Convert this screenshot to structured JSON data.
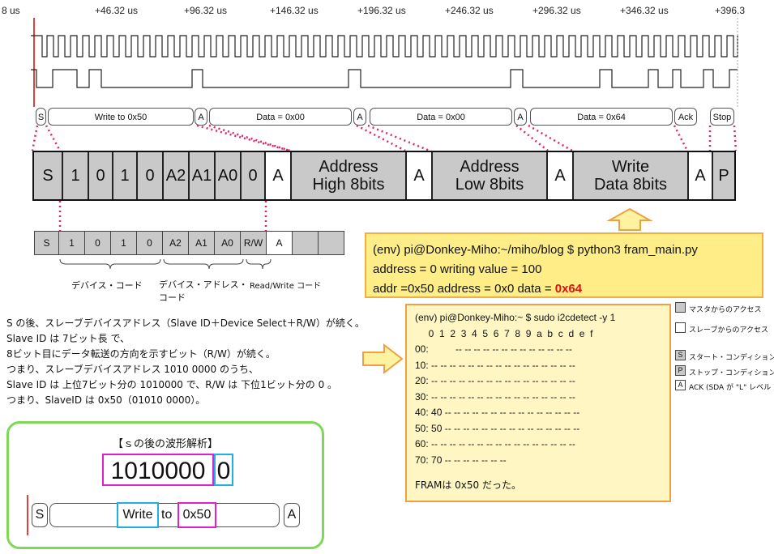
{
  "timeline": {
    "ticks": [
      "8 us",
      "+46.32 us",
      "+96.32 us",
      "+146.32 us",
      "+196.32 us",
      "+246.32 us",
      "+296.32 us",
      "+346.32 us",
      "+396.3"
    ]
  },
  "decode": {
    "s": "S",
    "write": "Write to 0x50",
    "a1": "A",
    "data1": "Data = 0x00",
    "a2": "A",
    "data2": "Data = 0x00",
    "a3": "A",
    "data3": "Data = 0x64",
    "ack": "Ack",
    "stop": "Stop"
  },
  "frame": {
    "s": "S",
    "b1": "1",
    "b2": "0",
    "b3": "1",
    "b4": "0",
    "a2": "A2",
    "a1": "A1",
    "a0": "A0",
    "rw": "0",
    "ack1": "A",
    "addr_high": "Address\nHigh 8bits",
    "ack2": "A",
    "addr_low": "Address\nLow 8bits",
    "ack3": "A",
    "write_data": "Write\nData 8bits",
    "ack4": "A",
    "p": "P"
  },
  "small_table": {
    "cells": [
      "S",
      "1",
      "0",
      "1",
      "0",
      "A2",
      "A1",
      "A0",
      "R/W",
      "A",
      "",
      ""
    ],
    "label_device_code": "デバイス・コード",
    "label_device_address": "デバイス・アドレス・\nコード",
    "label_rw": "Read/Write コード"
  },
  "python_box": {
    "line1": "(env) pi@Donkey-Miho:~/miho/blog $ python3 fram_main.py",
    "line2": "address = 0 writing value = 100",
    "line3_prefix": "addr =0x50 address = 0x0 data = ",
    "line3_value": "0x64"
  },
  "i2c_box": {
    "lines": [
      "(env) pi@Donkey-Miho:~ $ sudo i2cdetect -y 1",
      "     0  1  2  3  4  5  6  7  8  9  a  b  c  d  e  f",
      "00:          -- -- -- -- -- -- -- -- -- -- -- -- --",
      "10: -- -- -- -- -- -- -- -- -- -- -- -- -- -- -- --",
      "20: -- -- -- -- -- -- -- -- -- -- -- -- -- -- -- --",
      "30: -- -- -- -- -- -- -- -- -- -- -- -- -- -- -- --",
      "40: 40 -- -- -- -- -- -- -- -- -- -- -- -- -- -- --",
      "50: 50 -- -- -- -- -- -- -- -- -- -- -- -- -- -- --",
      "60: -- -- -- -- -- -- -- -- -- -- -- -- -- -- -- --",
      "70: 70 -- -- -- -- -- -- --"
    ],
    "footer": "FRAMは 0x50 だった。"
  },
  "explanation": {
    "lines": [
      "S の後、スレーブデバイスアドレス（Slave ID＋Device Select＋R/W）が続く。",
      "Slave ID は 7ビット長 で、",
      "8ビット目にデータ転送の方向を示すビット（R/W）が続く。",
      "つまり、スレーブデバイスアドレス 1010 0000 のうち、",
      "Slave ID は 上位7ビット分の 1010000 で、R/W は 下位1ビット分の 0 。",
      "つまり、SlaveID は 0x50（01010 0000）。"
    ]
  },
  "analysis": {
    "title": "【ｓの後の波形解析】",
    "bits_main": "1010000",
    "bits_last": "0",
    "seg_s": "S",
    "seg_write": "Write",
    "seg_to": "to",
    "seg_addr": "0x50",
    "seg_a": "A"
  },
  "legend": {
    "master": "マスタからのアクセス",
    "slave": "スレーブからのアクセス",
    "start_sym": "S",
    "start": "スタート・コンディション",
    "stop_sym": "P",
    "stop": "ストップ・コンディション",
    "ack_sym": "A",
    "ack": "ACK (SDA が \"L\" レベル )"
  },
  "colors": {
    "pink_dots": "#e0206a",
    "highlight_red": "#e01010",
    "green_border": "#7ed957",
    "magenta": "#e020d0",
    "cyan": "#20b0e0"
  }
}
